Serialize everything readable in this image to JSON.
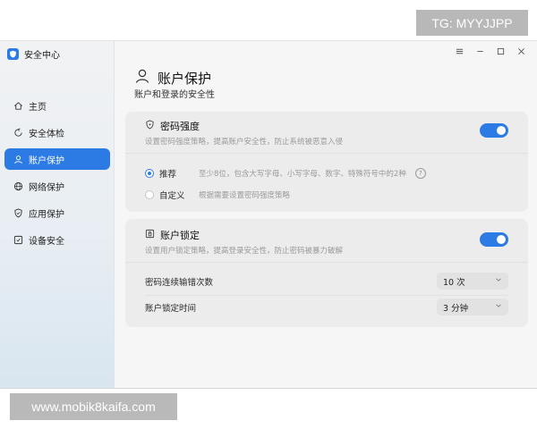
{
  "overlay": {
    "top_text": "TG: MYYJJPP",
    "bottom_text": "www.mobik8kaifa.com"
  },
  "app": {
    "title": "安全中心",
    "logo_icon": "shield-icon"
  },
  "sidebar": {
    "items": [
      {
        "label": "主页",
        "icon": "home-icon",
        "active": false
      },
      {
        "label": "安全体检",
        "icon": "checkup-icon",
        "active": false
      },
      {
        "label": "账户保护",
        "icon": "user-icon",
        "active": true
      },
      {
        "label": "网络保护",
        "icon": "globe-icon",
        "active": false
      },
      {
        "label": "应用保护",
        "icon": "shield-icon",
        "active": false
      },
      {
        "label": "设备安全",
        "icon": "device-icon",
        "active": false
      }
    ]
  },
  "window_controls": [
    "menu-icon",
    "minimize-icon",
    "maximize-icon",
    "close-icon"
  ],
  "page": {
    "title": "账户保护",
    "subtitle": "账户和登录的安全性",
    "header_icon": "user-icon"
  },
  "password_strength": {
    "title": "密码强度",
    "description": "设置密码强度策略，提高账户安全性，防止系统被恶意入侵",
    "enabled": true,
    "options": [
      {
        "label": "推荐",
        "hint": "至少8位，包含大写字母、小写字母、数字、特殊符号中的2种",
        "selected": true
      },
      {
        "label": "自定义",
        "hint": "根据需要设置密码强度策略",
        "selected": false
      }
    ]
  },
  "account_lock": {
    "title": "账户锁定",
    "description": "设置用户锁定策略，提高登录安全性，防止密码被暴力破解",
    "enabled": true,
    "fields": [
      {
        "label": "密码连续输错次数",
        "value": "10 次"
      },
      {
        "label": "账户锁定时间",
        "value": "3 分钟"
      }
    ]
  },
  "colors": {
    "accent": "#2c7be5",
    "card_bg": "#ececec"
  }
}
